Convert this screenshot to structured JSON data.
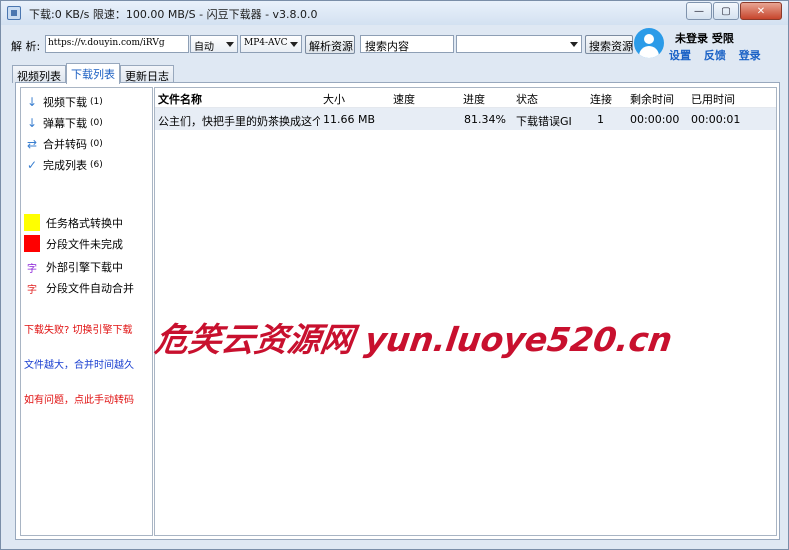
{
  "window": {
    "title": "下载:0 KB/s  限速：100.00 MB/S  - 闪豆下载器 - v3.8.0.0",
    "min_glyph": "—",
    "max_glyph": "▢",
    "close_glyph": "✕"
  },
  "toolbar": {
    "parse_label": "解 析:",
    "url_value": "https://v.douyin.com/iRVg",
    "quality_value": "自动",
    "format_value": "MP4-AVC",
    "parse_button": "解析资源",
    "search_placeholder": "搜索内容",
    "search_select_value": "",
    "search_button": "搜索资源"
  },
  "user": {
    "status": "未登录  受限",
    "links": [
      "设置",
      "反馈",
      "登录"
    ]
  },
  "tabs": [
    "视频列表",
    "下载列表",
    "更新日志"
  ],
  "sidebar": {
    "items": [
      {
        "icon": "↓",
        "label": "视频下载",
        "count": "(1)"
      },
      {
        "icon": "↓",
        "label": "弹幕下载",
        "count": "(0)"
      },
      {
        "icon": "⇄",
        "label": "合并转码",
        "count": "(0)"
      },
      {
        "icon": "✓",
        "label": "完成列表",
        "count": "(6)"
      }
    ],
    "legend": [
      {
        "color": "#ffff00",
        "label": "任务格式转换中"
      },
      {
        "color": "#ff0000",
        "label": "分段文件未完成"
      },
      {
        "char": "字",
        "char_color": "#8b22d8",
        "label": "外部引擎下载中"
      },
      {
        "char": "字",
        "char_color": "#e02020",
        "label": "分段文件自动合并"
      }
    ],
    "tips": [
      {
        "text": "下载失败? 切换引擎下载",
        "color": "#e01010"
      },
      {
        "text": "文件越大，合并时间越久",
        "color": "#1a3fd0"
      },
      {
        "text": "如有问题，点此手动转码",
        "color": "#e01010"
      }
    ]
  },
  "table": {
    "columns": [
      "文件名称",
      "大小",
      "速度",
      "进度",
      "状态",
      "连接",
      "剩余时间",
      "已用时间"
    ],
    "rows": [
      {
        "name": "公主们，快把手里的奶茶换成这个吧",
        "size": "11.66 MB",
        "speed": "",
        "progress": "81.34%",
        "status": "下载错误GIF",
        "connections": "1",
        "remaining": "00:00:00",
        "elapsed": "00:00:01"
      }
    ]
  },
  "watermark": "危笑云资源网  yun.luoye520.cn"
}
